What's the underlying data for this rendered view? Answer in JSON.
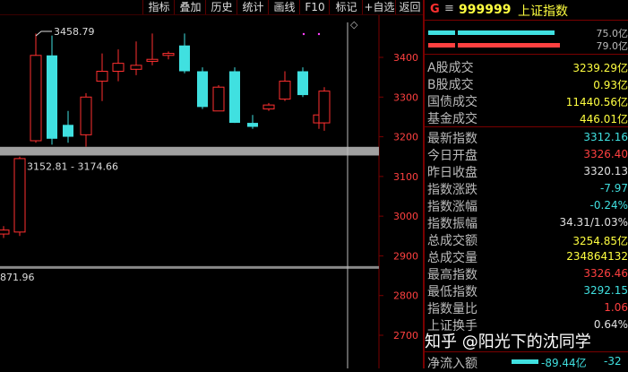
{
  "toolbar": {
    "items": [
      "指标",
      "叠加",
      "历史",
      "统计",
      "画线",
      "F10",
      "标记",
      "+自选",
      "返回"
    ]
  },
  "header": {
    "flag": "G",
    "menu": "≡",
    "code": "999999",
    "name": "上证指数"
  },
  "ratio_bars": {
    "top_label": "75.0亿",
    "bottom_label": "79.0亿",
    "top_color": "#40e0e0",
    "bottom_color": "#ff4040"
  },
  "stats": [
    {
      "label": "A股成交",
      "value": "3239.29亿",
      "color": "#ffff40"
    },
    {
      "label": "B股成交",
      "value": "0.93亿",
      "color": "#ffff40"
    },
    {
      "label": "国债成交",
      "value": "11440.56亿",
      "color": "#ffff40"
    },
    {
      "label": "基金成交",
      "value": "446.01亿",
      "color": "#ffff40"
    },
    {
      "label": "最新指数",
      "value": "3312.16",
      "color": "#40e0e0"
    },
    {
      "label": "今日开盘",
      "value": "3326.40",
      "color": "#ff4040"
    },
    {
      "label": "昨日收盘",
      "value": "3320.13",
      "color": "#e0e0e0"
    },
    {
      "label": "指数涨跌",
      "value": "-7.97",
      "color": "#40e0e0"
    },
    {
      "label": "指数涨幅",
      "value": "-0.24%",
      "color": "#40e0e0"
    },
    {
      "label": "指数振幅",
      "value": "34.31/1.03%",
      "color": "#e0e0e0"
    },
    {
      "label": "总成交额",
      "value": "3254.85亿",
      "color": "#ffff40"
    },
    {
      "label": "总成交量",
      "value": "234864132",
      "color": "#ffff40"
    },
    {
      "label": "最高指数",
      "value": "3326.46",
      "color": "#ff4040"
    },
    {
      "label": "最低指数",
      "value": "3292.15",
      "color": "#40e0e0"
    },
    {
      "label": "指数量比",
      "value": "1.06",
      "color": "#ff4040"
    },
    {
      "label": "上证换手",
      "value": "0.64%",
      "color": "#e0e0e0"
    }
  ],
  "netflow": {
    "label": "净流入额",
    "value1": "-89.44亿",
    "value2": "-32"
  },
  "watermark": "知乎 @阳光下的沈同学",
  "chart_data": {
    "type": "candlestick",
    "y_ticks": [
      3400,
      3300,
      3200,
      3100,
      3000,
      2900,
      2800,
      2700
    ],
    "annotations": {
      "high_label": "3458.79",
      "band_label": "3152.81 - 3174.66",
      "low_label": "871.96"
    },
    "band_range": [
      3152.81,
      3174.66
    ],
    "hline_value": 2871.96,
    "colors": {
      "up": "#ff3030",
      "down": "#40e0e0",
      "band": "#a0a0a0",
      "grid": "#7a0000"
    },
    "candles": [
      {
        "o": 2955,
        "h": 2975,
        "l": 2945,
        "c": 2965
      },
      {
        "o": 2960,
        "h": 3150,
        "l": 2950,
        "c": 3145
      },
      {
        "o": 3190,
        "h": 3460,
        "l": 3185,
        "c": 3405
      },
      {
        "o": 3405,
        "h": 3455,
        "l": 3180,
        "c": 3195
      },
      {
        "o": 3230,
        "h": 3265,
        "l": 3185,
        "c": 3200
      },
      {
        "o": 3205,
        "h": 3310,
        "l": 3175,
        "c": 3300
      },
      {
        "o": 3340,
        "h": 3410,
        "l": 3290,
        "c": 3365
      },
      {
        "o": 3365,
        "h": 3420,
        "l": 3340,
        "c": 3385
      },
      {
        "o": 3370,
        "h": 3440,
        "l": 3355,
        "c": 3380
      },
      {
        "o": 3390,
        "h": 3460,
        "l": 3380,
        "c": 3395
      },
      {
        "o": 3405,
        "h": 3415,
        "l": 3395,
        "c": 3410
      },
      {
        "o": 3430,
        "h": 3460,
        "l": 3360,
        "c": 3365
      },
      {
        "o": 3365,
        "h": 3375,
        "l": 3270,
        "c": 3275
      },
      {
        "o": 3265,
        "h": 3330,
        "l": 3265,
        "c": 3325
      },
      {
        "o": 3365,
        "h": 3375,
        "l": 3235,
        "c": 3235
      },
      {
        "o": 3235,
        "h": 3255,
        "l": 3220,
        "c": 3225
      },
      {
        "o": 3270,
        "h": 3285,
        "l": 3265,
        "c": 3280
      },
      {
        "o": 3295,
        "h": 3365,
        "l": 3290,
        "c": 3340
      },
      {
        "o": 3365,
        "h": 3375,
        "l": 3300,
        "c": 3305
      },
      {
        "o": 3235,
        "h": 3260,
        "l": 3220,
        "c": 3255
      },
      {
        "o": 3235,
        "h": 3325,
        "l": 3215,
        "c": 3315
      }
    ]
  }
}
